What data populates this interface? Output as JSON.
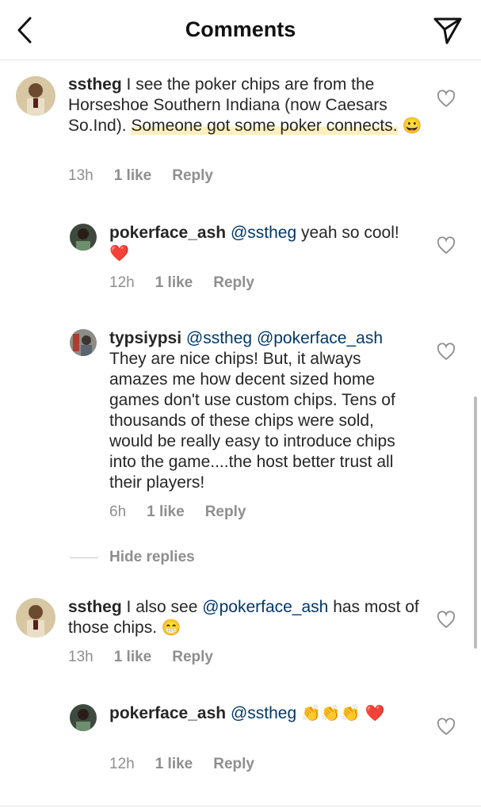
{
  "header": {
    "title": "Comments",
    "back_icon": "chevron-left-icon",
    "send_icon": "paper-plane-icon"
  },
  "comments": [
    {
      "username": "sstheg",
      "text_plain": "I see the poker chips are from the Horseshoe Southern Indiana (now Caesars So.Ind).",
      "text_highlighted": "Someone got some poker connects.",
      "emoji": "😀",
      "time": "13h",
      "likes": "1 like",
      "reply": "Reply"
    },
    {
      "username": "pokerface_ash",
      "mention": "@sstheg",
      "text": "yeah so cool!",
      "emoji": "❤️",
      "time": "12h",
      "likes": "1 like",
      "reply": "Reply"
    },
    {
      "username": "typsiypsi",
      "mention1": "@sstheg",
      "mention2": "@pokerface_ash",
      "text": "They are nice chips!  But, it always amazes me how decent sized home games don't use custom chips. Tens of thousands of these chips were sold, would be really easy to introduce chips into the game....the host better trust all their players!",
      "time": "6h",
      "likes": "1 like",
      "reply": "Reply"
    },
    {
      "username": "sstheg",
      "text_before": "I also see",
      "mention": "@pokerface_ash",
      "text_after": "has most of those chips.",
      "emoji": "😁",
      "time": "13h",
      "likes": "1 like",
      "reply": "Reply"
    },
    {
      "username": "pokerface_ash",
      "mention": "@sstheg",
      "emoji": "👏👏👏",
      "emoji2": "❤️",
      "time": "12h",
      "likes": "1 like",
      "reply": "Reply"
    }
  ],
  "hide_replies": "Hide replies",
  "colors": {
    "mention": "#00376b",
    "meta": "#8e8e8e",
    "highlight": "#fde28c"
  }
}
